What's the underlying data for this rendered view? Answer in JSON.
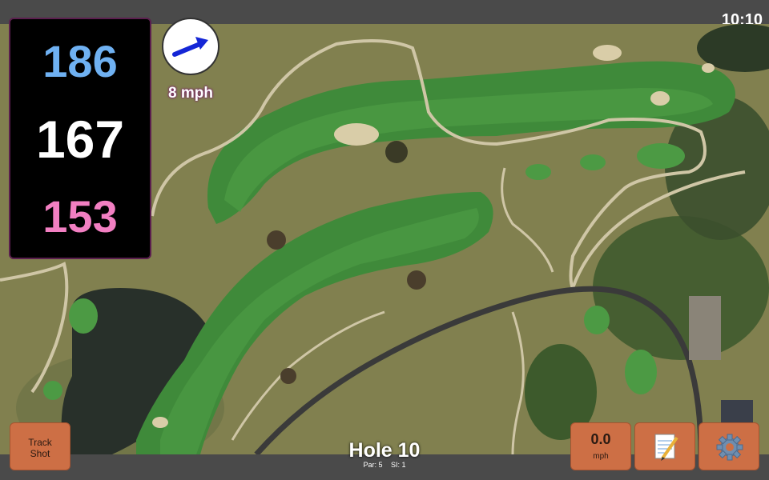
{
  "status": {
    "clock": "10:10"
  },
  "distances": {
    "back": "186",
    "middle": "167",
    "front": "153"
  },
  "wind": {
    "speed_label": "8 mph",
    "direction_icon": "arrow-up-right-icon"
  },
  "hole": {
    "title": "Hole 10",
    "par": "Par: 5",
    "si": "SI: 1"
  },
  "buttons": {
    "track_shot_line1": "Track",
    "track_shot_line2": "Shot",
    "speed_value": "0.0",
    "speed_unit": "mph",
    "notes_icon": "notepad-pencil-icon",
    "settings_icon": "gear-icon"
  },
  "colors": {
    "back_distance": "#6fb1f2",
    "middle_distance": "#ffffff",
    "front_distance": "#f27fc2",
    "button_bg": "#cd6f45",
    "bar_bg": "#4a4a4a"
  }
}
